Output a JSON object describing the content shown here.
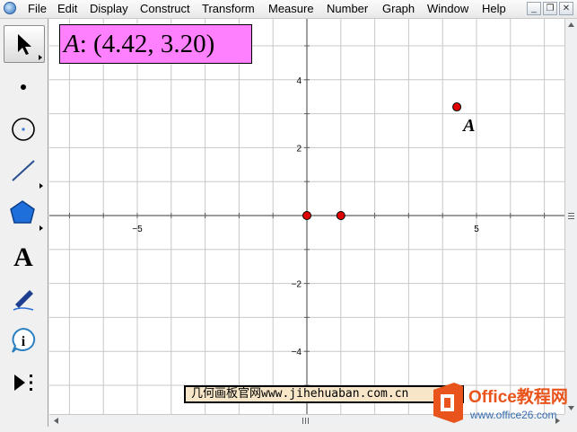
{
  "menu": {
    "items": [
      "File",
      "Edit",
      "Display",
      "Construct",
      "Transform",
      "Measure",
      "Number",
      "Graph",
      "Window",
      "Help"
    ]
  },
  "window_controls": {
    "minimize": "_",
    "restore": "❐",
    "close": "✕"
  },
  "measurement": {
    "label": "A",
    "value": ": (4.42, 3.20)"
  },
  "graph": {
    "x_range": [
      -7.1,
      7.1
    ],
    "y_range": [
      -5.3,
      5.3
    ],
    "grid_spacing": 1,
    "x_tick_labels": [
      {
        "value": -5,
        "text": "−5"
      },
      {
        "value": 5,
        "text": "5"
      }
    ],
    "y_tick_labels": [
      {
        "value": 4,
        "text": "4"
      },
      {
        "value": 2,
        "text": "2"
      },
      {
        "value": -2,
        "text": "−2"
      },
      {
        "value": -4,
        "text": "−4"
      }
    ],
    "points": [
      {
        "name": "origin",
        "x": 0,
        "y": 0,
        "label": ""
      },
      {
        "name": "unit-point",
        "x": 1,
        "y": 0,
        "label": ""
      },
      {
        "name": "point-A",
        "x": 4.42,
        "y": 3.2,
        "label": "A"
      }
    ],
    "point_color": "#e00000",
    "grid_color": "#c8c8c8",
    "axis_color": "#606060"
  },
  "toolbox": {
    "tools": [
      {
        "name": "arrow-tool",
        "icon": "arrow-pointer-icon"
      },
      {
        "name": "point-tool",
        "icon": "dot-icon"
      },
      {
        "name": "compass-tool",
        "icon": "circle-icon"
      },
      {
        "name": "straightedge-tool",
        "icon": "segment-icon"
      },
      {
        "name": "polygon-tool",
        "icon": "pentagon-icon"
      },
      {
        "name": "text-tool",
        "icon": "letter-a-icon",
        "glyph": "A"
      },
      {
        "name": "marker-tool",
        "icon": "pen-icon"
      },
      {
        "name": "information-tool",
        "icon": "info-icon",
        "glyph": "i"
      },
      {
        "name": "custom-tool",
        "icon": "play-more-icon"
      }
    ]
  },
  "watermark": {
    "text": "几何画板官网www.jihehuaban.com.cn"
  },
  "logo": {
    "brand": "Office教程网",
    "url": "www.office26.com",
    "color": "#e8541b"
  }
}
